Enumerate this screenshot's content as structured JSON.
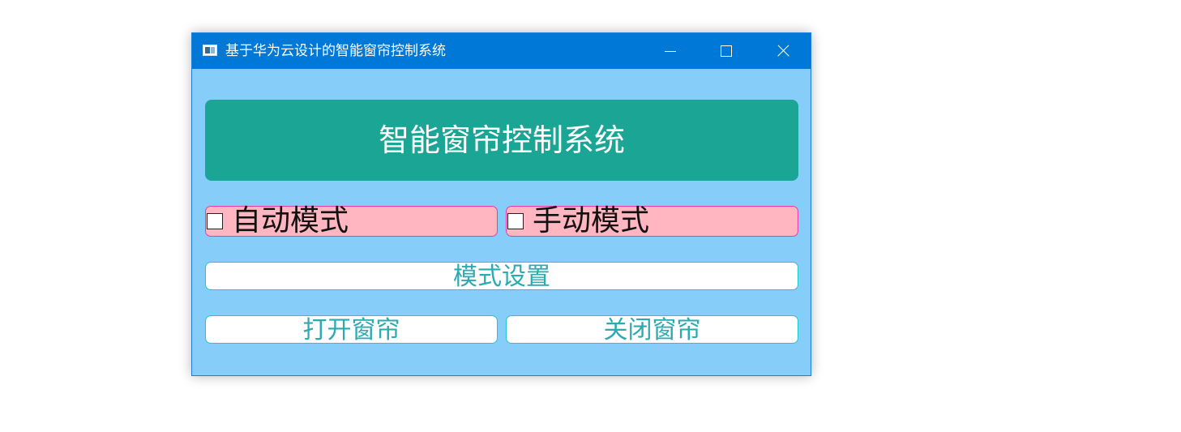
{
  "window": {
    "title": "基于华为云设计的智能窗帘控制系统",
    "icons": {
      "app": "app-window-icon",
      "minimize": "minimize-icon",
      "maximize": "maximize-icon",
      "close": "close-icon"
    }
  },
  "main": {
    "banner_title": "智能窗帘控制系统",
    "modes": [
      {
        "label": "自动模式",
        "checked": false
      },
      {
        "label": "手动模式",
        "checked": false
      }
    ],
    "buttons": {
      "mode_setting": "模式设置",
      "open_curtain": "打开窗帘",
      "close_curtain": "关闭窗帘"
    }
  },
  "colors": {
    "titlebar": "#0078d7",
    "background": "#87cdf9",
    "banner": "#1aa594",
    "mode_box": "#ffb6c1",
    "mode_border": "#e93ba8",
    "button_text": "#2aaab1",
    "button_border": "#20c9c9"
  }
}
